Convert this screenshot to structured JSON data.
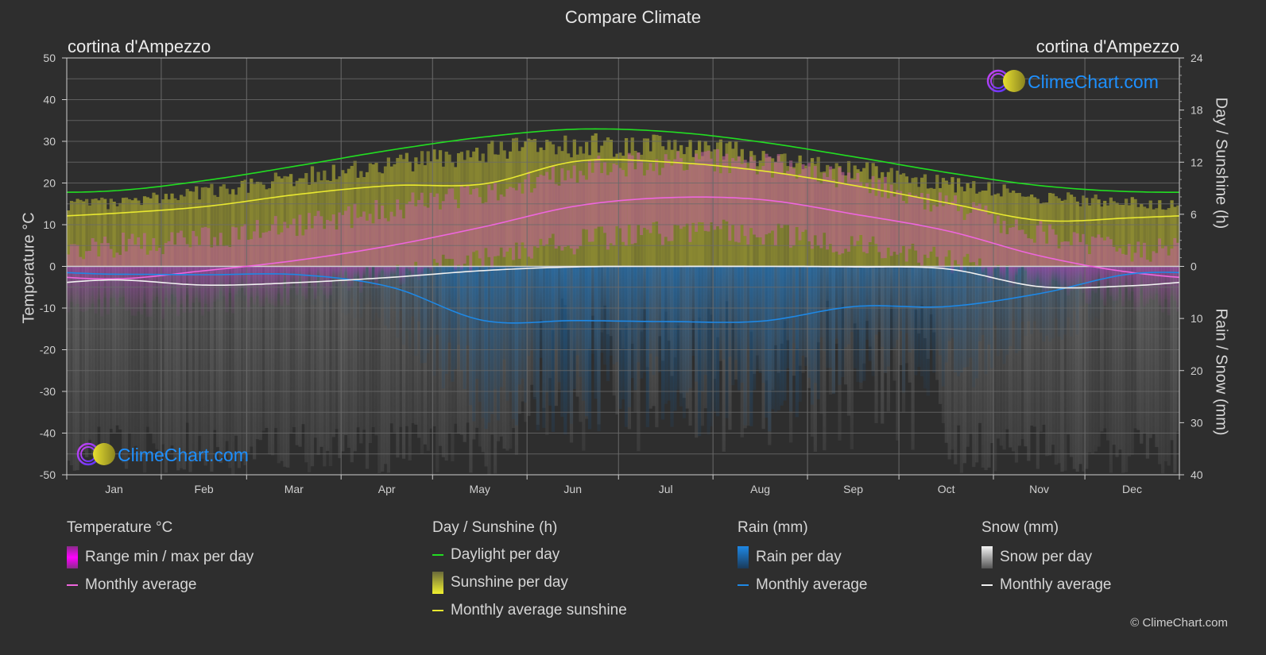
{
  "title": "Compare Climate",
  "location_left": "cortina d'Ampezzo",
  "location_right": "cortina d'Ampezzo",
  "watermark": "ClimeChart.com",
  "copyright": "© ClimeChart.com",
  "colors": {
    "background": "#2e2e2e",
    "daylight": "#22dd22",
    "sunshine_avg": "#e8e830",
    "temp_avg": "#ee66dd",
    "rain_avg": "#1e88e5",
    "snow_avg": "#f0f0f0",
    "sunshine_fill": "#8c8a32",
    "temp_fill": "#c0609a",
    "rain_fill": "#1f5a88",
    "snow_fill": "#6a6a6a",
    "grid": "#5a5a5a",
    "brand_blue": "#1e90ff"
  },
  "legend": {
    "groups": [
      {
        "title": "Temperature °C",
        "items": [
          {
            "label": "Range min / max per day",
            "type": "box",
            "icon": "temp-range-swatch"
          },
          {
            "label": "Monthly average",
            "type": "line",
            "icon": "temp-average-swatch"
          }
        ]
      },
      {
        "title": "Day / Sunshine (h)",
        "items": [
          {
            "label": "Daylight per day",
            "type": "line",
            "icon": "daylight-swatch"
          },
          {
            "label": "Sunshine per day",
            "type": "box",
            "icon": "sunshine-swatch"
          },
          {
            "label": "Monthly average sunshine",
            "type": "line",
            "icon": "sunshine-average-swatch"
          }
        ]
      },
      {
        "title": "Rain (mm)",
        "items": [
          {
            "label": "Rain per day",
            "type": "box",
            "icon": "rain-swatch"
          },
          {
            "label": "Monthly average",
            "type": "line",
            "icon": "rain-average-swatch"
          }
        ]
      },
      {
        "title": "Snow (mm)",
        "items": [
          {
            "label": "Snow per day",
            "type": "box",
            "icon": "snow-swatch"
          },
          {
            "label": "Monthly average",
            "type": "line",
            "icon": "snow-average-swatch"
          }
        ]
      }
    ]
  },
  "chart_data": {
    "type": "line",
    "title": "Compare Climate",
    "categories": [
      "Jan",
      "Feb",
      "Mar",
      "Apr",
      "May",
      "Jun",
      "Jul",
      "Aug",
      "Sep",
      "Oct",
      "Nov",
      "Dec"
    ],
    "y_left": {
      "label": "Temperature °C",
      "range": [
        -50,
        50
      ],
      "ticks": [
        50,
        40,
        30,
        20,
        10,
        0,
        -10,
        -20,
        -30,
        -40,
        -50
      ]
    },
    "y_right_top": {
      "label": "Day / Sunshine (h)",
      "range": [
        0,
        24
      ],
      "ticks": [
        24,
        18,
        12,
        6,
        0
      ]
    },
    "y_right_bottom": {
      "label": "Rain / Snow (mm)",
      "range": [
        0,
        40
      ],
      "ticks": [
        0,
        10,
        20,
        30,
        40
      ]
    },
    "grid": true,
    "series": [
      {
        "name": "Temperature monthly average",
        "axis": "left",
        "unit": "°C",
        "values": [
          -3,
          -1,
          1.5,
          5,
          9.5,
          14.5,
          16.5,
          16,
          12.5,
          8.5,
          2.5,
          -1.5
        ]
      },
      {
        "name": "Daylight per day",
        "axis": "right_top",
        "unit": "h",
        "values": [
          8.7,
          9.9,
          11.6,
          13.4,
          14.9,
          15.8,
          15.5,
          14.3,
          12.6,
          10.8,
          9.3,
          8.6
        ]
      },
      {
        "name": "Monthly average sunshine",
        "axis": "right_top",
        "unit": "h",
        "values": [
          6.1,
          6.9,
          8.3,
          9.3,
          9.5,
          12.1,
          12.0,
          11.0,
          9.3,
          7.3,
          5.3,
          5.6
        ]
      },
      {
        "name": "Rain monthly average",
        "axis": "right_bottom",
        "unit": "mm",
        "values": [
          1.5,
          1.6,
          1.6,
          4.0,
          10.4,
          10.4,
          10.6,
          10.5,
          7.7,
          7.7,
          5.2,
          1.4
        ]
      },
      {
        "name": "Snow monthly average",
        "axis": "right_bottom",
        "unit": "mm",
        "values": [
          2.6,
          3.6,
          3.1,
          2.1,
          0.8,
          0.1,
          0.0,
          0.0,
          0.1,
          0.5,
          3.9,
          3.7
        ]
      }
    ],
    "range_bands": {
      "sunshine_per_day_top_h": [
        7.4,
        8.8,
        10.5,
        12.0,
        13.4,
        14.2,
        14.0,
        13.0,
        11.4,
        9.7,
        8.2,
        7.5
      ],
      "temp_max_avg_c": [
        5,
        7,
        10,
        14,
        18,
        23,
        25,
        24.5,
        20,
        15,
        8,
        4
      ],
      "temp_min_avg_c": [
        -10,
        -9,
        -6,
        -2,
        2,
        6,
        8,
        8,
        5,
        1,
        -4,
        -8
      ]
    },
    "legend_position": "bottom"
  }
}
